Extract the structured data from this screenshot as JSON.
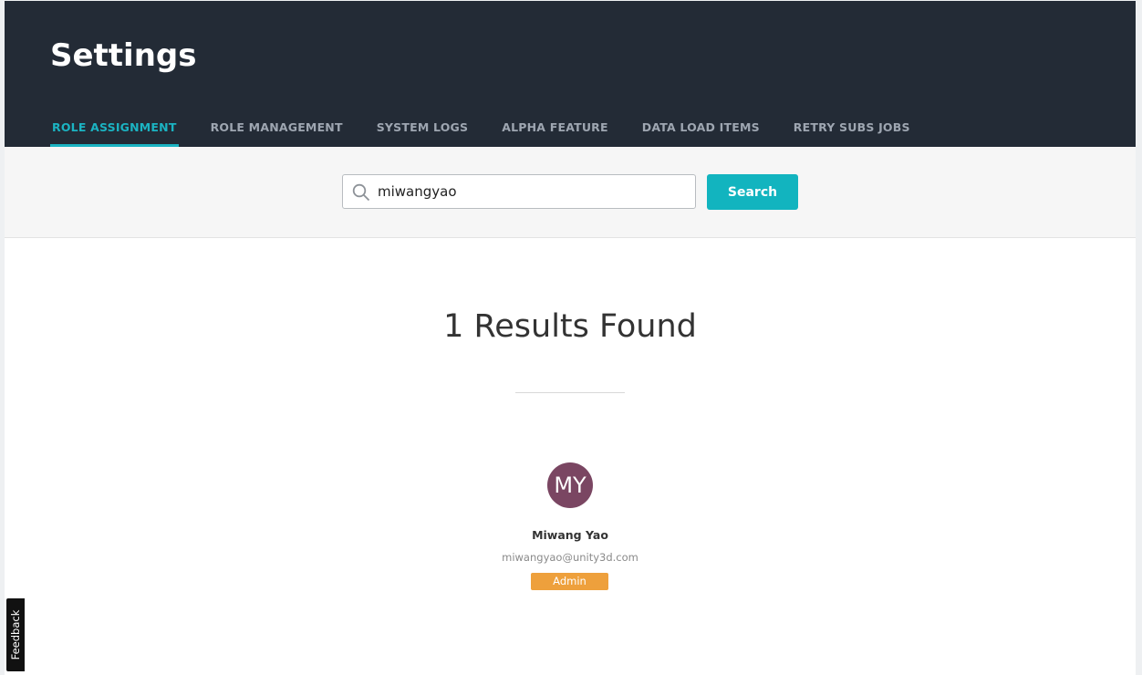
{
  "header": {
    "title": "Settings",
    "tabs": [
      {
        "label": "ROLE ASSIGNMENT",
        "active": true
      },
      {
        "label": "ROLE MANAGEMENT",
        "active": false
      },
      {
        "label": "SYSTEM LOGS",
        "active": false
      },
      {
        "label": "ALPHA FEATURE",
        "active": false
      },
      {
        "label": "DATA LOAD ITEMS",
        "active": false
      },
      {
        "label": "RETRY SUBS JOBS",
        "active": false
      }
    ]
  },
  "search": {
    "value": "miwangyao",
    "button_label": "Search",
    "icon": "search-icon"
  },
  "results": {
    "title": "1 Results Found",
    "users": [
      {
        "initials": "MY",
        "name": "Miwang Yao",
        "email": "miwangyao@unity3d.com",
        "role": "Admin",
        "avatar_color": "#7a4662",
        "role_color": "#eea03c"
      }
    ]
  },
  "feedback": {
    "label": "Feedback"
  },
  "colors": {
    "header_bg": "#232b36",
    "accent": "#1bb3c2",
    "search_button": "#12b4bf"
  }
}
